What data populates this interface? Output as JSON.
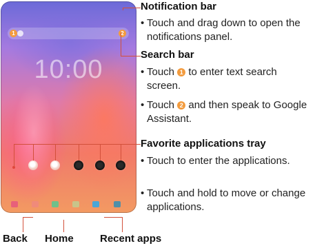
{
  "tablet": {
    "clock": "10:00",
    "search_markers": [
      "1",
      "2"
    ]
  },
  "sections": [
    {
      "heading": "Notification bar",
      "bullets": [
        "Touch and drag down to open the notifications panel."
      ]
    },
    {
      "heading": "Search bar",
      "bullets": [
        {
          "before": "Touch ",
          "marker": "1",
          "after": " to enter text search screen."
        },
        {
          "before": "Touch ",
          "marker": "2",
          "after": " and then speak to Google Assistant."
        }
      ]
    },
    {
      "heading": "Favorite applications tray",
      "bullets": [
        "Touch to enter the applications.",
        "Touch and hold to move or change applications."
      ]
    }
  ],
  "bottom_labels": {
    "back": "Back",
    "home": "Home",
    "recent": "Recent apps"
  },
  "colors": {
    "accent_line": "#d2503a",
    "marker": "#f39b3d"
  }
}
